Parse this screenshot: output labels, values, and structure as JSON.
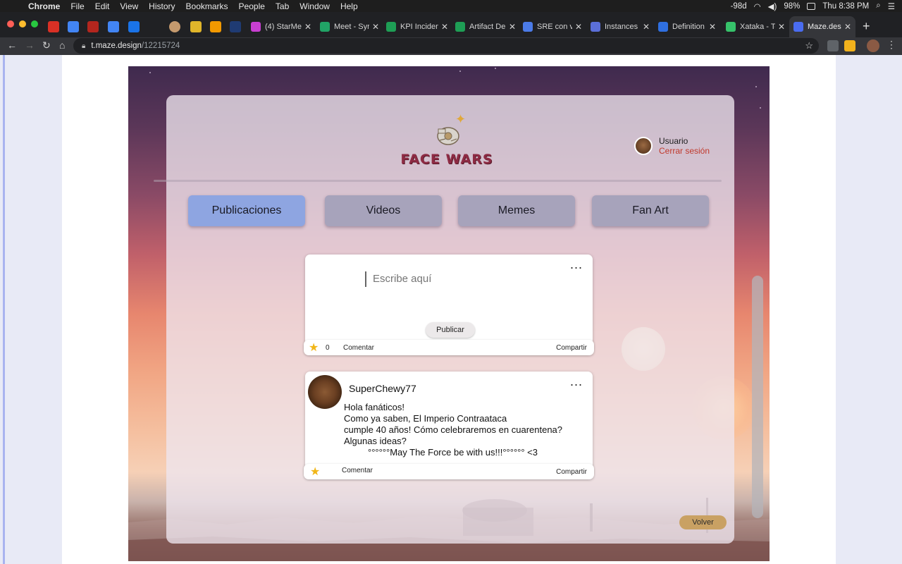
{
  "menubar": {
    "app_name": "Chrome",
    "items": [
      "File",
      "Edit",
      "View",
      "History",
      "Bookmarks",
      "People",
      "Tab",
      "Window",
      "Help"
    ],
    "status": {
      "temperature": "-98d",
      "battery": "98%",
      "clock": "Thu 8:38 PM"
    }
  },
  "tabs": [
    {
      "title": "(4) StarMe",
      "color": "#c83fd1"
    },
    {
      "title": "Meet - Syr",
      "color": "#21a366"
    },
    {
      "title": "KPI Inciden",
      "color": "#1e9e55"
    },
    {
      "title": "Artifact De",
      "color": "#1e9e55"
    },
    {
      "title": "SRE con vi",
      "color": "#4b7be8"
    },
    {
      "title": "Instances",
      "color": "#5b6fd8"
    },
    {
      "title": "Definition",
      "color": "#2f6fe0"
    },
    {
      "title": "Xataka - Te",
      "color": "#36c26a"
    },
    {
      "title": "Maze.desig",
      "color": "#4a6cf0"
    }
  ],
  "address": {
    "host": "t.maze.design",
    "path": "/12215724"
  },
  "app": {
    "logo_text": "FACE WARS",
    "user_name": "Usuario",
    "logout_label": "Cerrar sesión",
    "nav": [
      "Publicaciones",
      "Videos",
      "Memes",
      "Fan Art"
    ],
    "composer": {
      "placeholder": "Escribe aquí",
      "publish_label": "Publicar",
      "more_label": "...",
      "likes": "0",
      "comment_label": "Comentar",
      "share_label": "Compartir"
    },
    "post": {
      "author": "SuperChewy77",
      "more_label": "...",
      "lines": [
        "Hola fanáticos!",
        "Como ya saben, El Imperio Contraataca",
        "cumple 40 años! Cómo celebraremos en cuarentena?",
        "Algunas ideas?",
        "°°°°°°May The Force be with us!!!°°°°°° <3"
      ],
      "comment_label": "Comentar",
      "share_label": "Compartir"
    },
    "back_label": "Volver"
  }
}
